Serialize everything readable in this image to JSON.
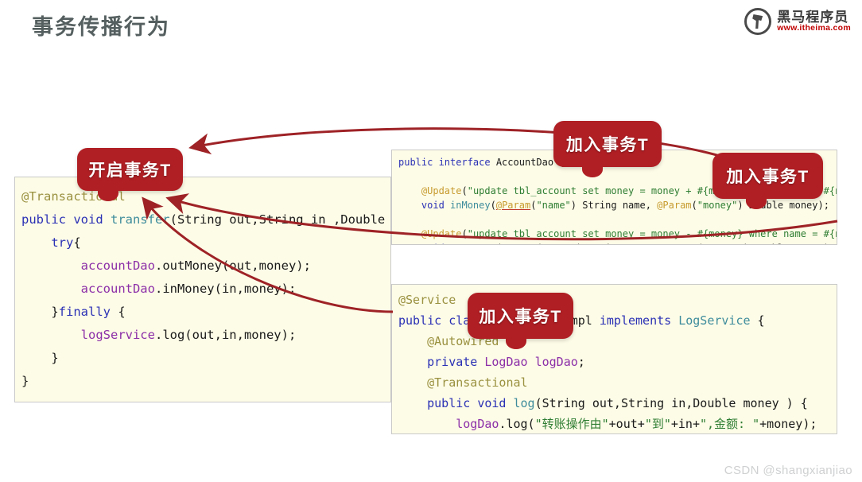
{
  "header": {
    "title": "事务传播行为",
    "logo_cn": "黑马程序员",
    "logo_url": "www.itheima.com",
    "logo_icon": "horse-head-circle-icon"
  },
  "colors": {
    "callout_red": "#b01f24",
    "arrow_red": "#9e2226",
    "code_bg": "#fdfce7",
    "title_gray": "#555f5f",
    "logo_url_red": "#c00000",
    "watermark_gray": "#cfd0d1"
  },
  "panels": {
    "service": {
      "name": "AccountServiceImpl transfer method",
      "lines": [
        "@Transactional",
        "public void transfer(String out,String in ,Double money",
        "    try{",
        "        accountDao.outMoney(out,money);",
        "        accountDao.inMoney(in,money);",
        "    }finally {",
        "        logService.log(out,in,money);",
        "    }",
        "}"
      ]
    },
    "dao": {
      "name": "AccountDao interface",
      "lines": [
        "public interface AccountDao {",
        "",
        "    @Update(\"update tbl_account set money = money + #{money} where name = #{name}\")",
        "    void inMoney(@Param(\"name\") String name, @Param(\"money\") Double money);",
        "",
        "    @Update(\"update tbl_account set money = money - #{money} where name = #{name}\")",
        "    void outMoney(@Param(\"name\") String name, @Param(\"money\") Double money);",
        "}"
      ]
    },
    "logimpl": {
      "name": "LogServiceImpl class",
      "lines": [
        "@Service",
        "public class LogServiceImpl implements LogService {",
        "    @Autowired",
        "    private LogDao logDao;",
        "    @Transactional",
        "    public void log(String out,String in,Double money ) {",
        "        logDao.log(\"转账操作由\"+out+\"到\"+in+\",金额: \"+money);",
        "    }",
        "}"
      ]
    }
  },
  "callouts": [
    {
      "id": "start",
      "label": "开启事务T"
    },
    {
      "id": "join1",
      "label": "加入事务T"
    },
    {
      "id": "join2",
      "label": "加入事务T"
    },
    {
      "id": "join3",
      "label": "加入事务T"
    }
  ],
  "arrows": [
    {
      "from": "dao-panel-top-right",
      "to": "start-callout"
    },
    {
      "from": "dao-panel-outMoney-line",
      "to": "start-callout"
    },
    {
      "from": "logimpl-panel-left",
      "to": "start-callout"
    }
  ],
  "watermark": "CSDN @shangxianjiao"
}
